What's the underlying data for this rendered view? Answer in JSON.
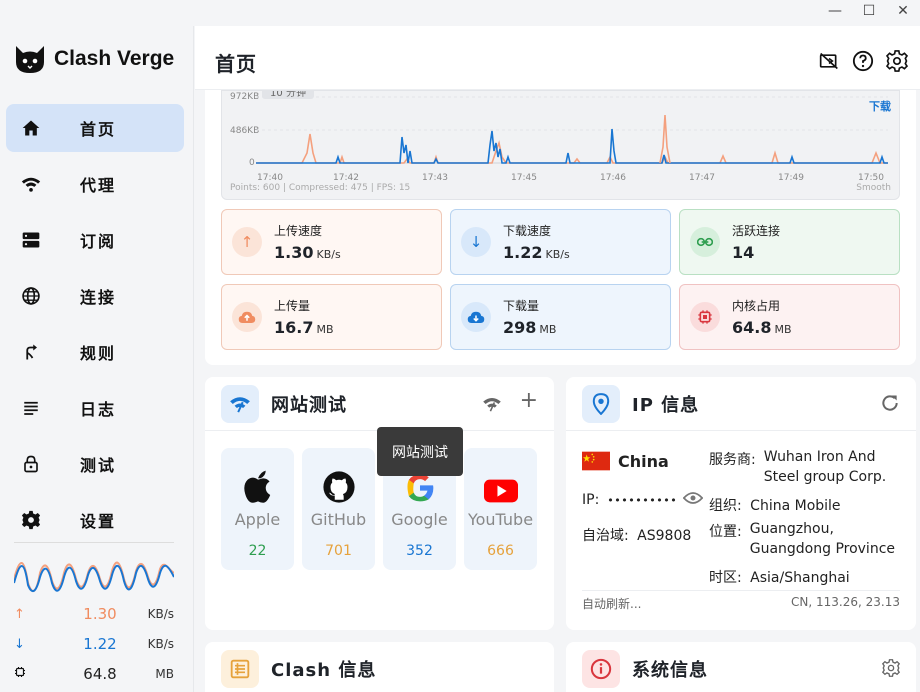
{
  "window": {
    "minimize": "—",
    "maximize": "☐",
    "close": "✕"
  },
  "app": {
    "name": "Clash Verge"
  },
  "sidebar": {
    "items": [
      {
        "label": "首页",
        "icon": "home-icon",
        "active": true
      },
      {
        "label": "代理",
        "icon": "wifi-icon",
        "active": false
      },
      {
        "label": "订阅",
        "icon": "storage-icon",
        "active": false
      },
      {
        "label": "连接",
        "icon": "globe-icon",
        "active": false
      },
      {
        "label": "规则",
        "icon": "fork-right-icon",
        "active": false
      },
      {
        "label": "日志",
        "icon": "list-icon",
        "active": false
      },
      {
        "label": "测试",
        "icon": "lock-icon",
        "active": false
      },
      {
        "label": "设置",
        "icon": "gear-icon",
        "active": false
      }
    ],
    "traffic": {
      "upload": {
        "value": "1.30",
        "unit": "KB/s"
      },
      "download": {
        "value": "1.22",
        "unit": "KB/s"
      },
      "memory": {
        "value": "64.8",
        "unit": "MB"
      }
    }
  },
  "header": {
    "title": "首页"
  },
  "traffic_chart": {
    "range_pill": "10 分钟",
    "y_ticks": [
      "972KB",
      "486KB",
      "0"
    ],
    "x_ticks": [
      "17:40",
      "17:42",
      "17:43",
      "17:45",
      "17:46",
      "17:47",
      "17:49",
      "17:50"
    ],
    "legend": "下载",
    "footer": "Points: 600 | Compressed: 475 | FPS: 15",
    "smooth_label": "Smooth",
    "colors": {
      "upload": "#f4a07e",
      "download": "#1976d2"
    }
  },
  "stats": [
    {
      "label": "上传速度",
      "value": "1.30",
      "unit": "KB/s",
      "icon": "arrow-up-icon",
      "tone": "orange"
    },
    {
      "label": "下载速度",
      "value": "1.22",
      "unit": "KB/s",
      "icon": "arrow-down-icon",
      "tone": "blue"
    },
    {
      "label": "活跃连接",
      "value": "14",
      "unit": "",
      "icon": "link-icon",
      "tone": "green"
    },
    {
      "label": "上传量",
      "value": "16.7",
      "unit": "MB",
      "icon": "cloud-upload-icon",
      "tone": "orange"
    },
    {
      "label": "下载量",
      "value": "298",
      "unit": "MB",
      "icon": "cloud-download-icon",
      "tone": "blue"
    },
    {
      "label": "内核占用",
      "value": "64.8",
      "unit": "MB",
      "icon": "memory-icon",
      "tone": "red"
    }
  ],
  "site_test": {
    "title": "网站测试",
    "tooltip": "网站测试",
    "sites": [
      {
        "name": "Apple",
        "latency": "22",
        "color": "#2e9e4f"
      },
      {
        "name": "GitHub",
        "latency": "701",
        "color": "#e6a23c"
      },
      {
        "name": "Google",
        "latency": "352",
        "color": "#1976d2"
      },
      {
        "name": "YouTube",
        "latency": "666",
        "color": "#e6a23c"
      }
    ]
  },
  "ip_info": {
    "title": "IP 信息",
    "country": "China",
    "ip_label": "IP:",
    "ip_masked": "••••••••••",
    "asn_label": "自治域:",
    "asn": "AS9808",
    "isp_label": "服务商:",
    "isp": "Wuhan Iron And Steel group Corp.",
    "org_label": "组织:",
    "org": "China Mobile",
    "location_label": "位置:",
    "location": "Guangzhou, Guangdong Province",
    "timezone_label": "时区:",
    "timezone": "Asia/Shanghai",
    "auto_refresh": "自动刷新...",
    "footer_right": "CN, 113.26, 23.13"
  },
  "clash_info": {
    "title": "Clash 信息"
  },
  "system_info": {
    "title": "系统信息"
  }
}
